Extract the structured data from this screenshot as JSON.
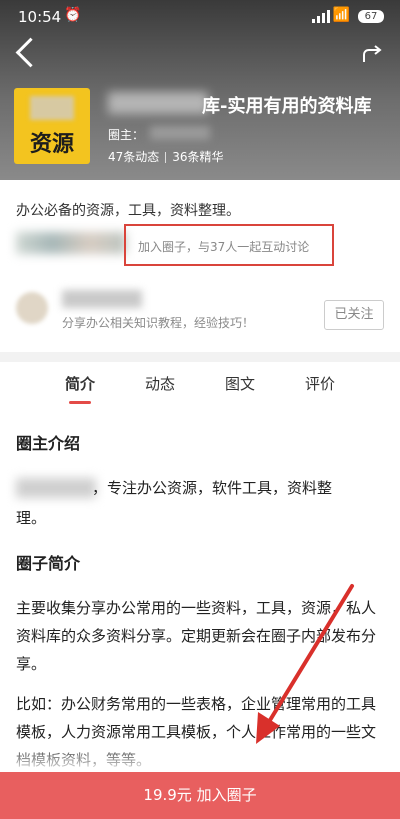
{
  "status_bar": {
    "time": "10:54",
    "battery": "67"
  },
  "circle": {
    "avatar_text": "资源",
    "title": "库-实用有用的资料库",
    "owner_label": "圈主：",
    "posts": "47条动态",
    "featured": "36条精华",
    "description": "办公必备的资源，工具，资料整理。",
    "join_invite": "加入圈子，与37人一起互动讨论"
  },
  "owner_card": {
    "subtitle": "分享办公相关知识教程，经验技巧！",
    "follow_label": "已关注"
  },
  "tabs": [
    {
      "label": "简介"
    },
    {
      "label": "动态"
    },
    {
      "label": "图文"
    },
    {
      "label": "评价"
    }
  ],
  "content": {
    "owner_intro_heading": "圈主介绍",
    "owner_intro_line1": "，专注办公资源，软件工具，资料整",
    "owner_intro_line2": "理。",
    "circle_intro_heading": "圈子简介",
    "circle_intro_p1": "主要收集分享办公常用的一些资料，工具，资源，私人资料库的众多资料分享。定期更新会在圈子内部发布分享。",
    "circle_intro_p2": "比如：办公财务常用的一些表格，企业管理常用的工具模板，人力资源常用工具模板，个人工作常用的一些文档模板资料，等等。"
  },
  "bottom_bar": {
    "join_button": "19.9元 加入圈子"
  },
  "colors": {
    "accent": "#e34b47",
    "join_bar": "#e85f5f",
    "avatar_bg": "#f3c41f",
    "highlight_box": "#d9443b"
  }
}
